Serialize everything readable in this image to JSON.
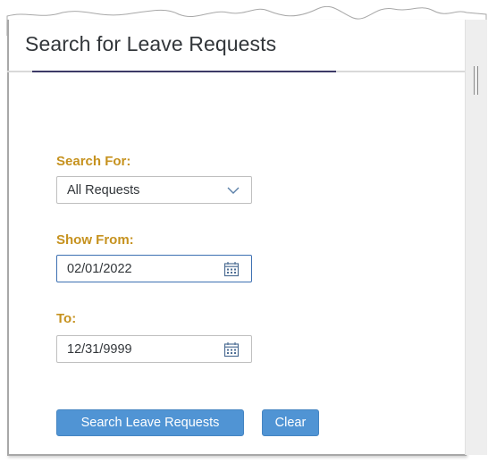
{
  "page": {
    "title": "Search for Leave Requests"
  },
  "form": {
    "search_for": {
      "label": "Search For:",
      "value": "All Requests",
      "icon": "chevron-down-icon"
    },
    "show_from": {
      "label": "Show From:",
      "value": "02/01/2022",
      "icon": "calendar-icon"
    },
    "to": {
      "label": "To:",
      "value": "12/31/9999",
      "icon": "calendar-icon"
    }
  },
  "actions": {
    "search_label": "Search Leave Requests",
    "clear_label": "Clear"
  },
  "colors": {
    "label_gold": "#c6921f",
    "button_blue": "#5094d4",
    "title_text": "#32363a",
    "title_underline": "#3c3a67",
    "focus_border": "#3d70b2"
  }
}
